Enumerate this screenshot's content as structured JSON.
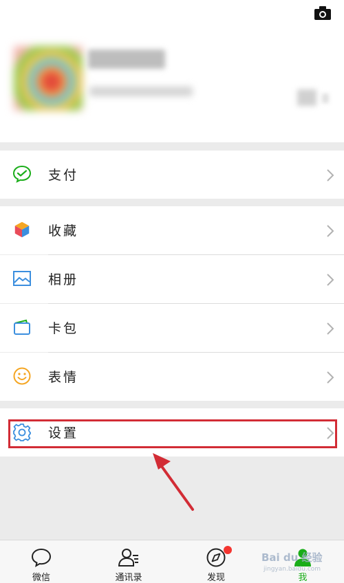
{
  "menu": {
    "pay_label": "支付",
    "favorites_label": "收藏",
    "album_label": "相册",
    "cards_label": "卡包",
    "stickers_label": "表情",
    "settings_label": "设置"
  },
  "tabbar": {
    "chats_label": "微信",
    "contacts_label": "通讯录",
    "discover_label": "发现",
    "me_label": "我"
  },
  "watermark": {
    "text": "Bai du 经验",
    "sub": "jingyan.baidu.com"
  },
  "colors": {
    "accent_green": "#1aad19",
    "highlight_red": "#d22c35",
    "badge_red": "#f43530",
    "icon_blue": "#3b8ede"
  },
  "icons": [
    "camera-icon",
    "pay-icon",
    "favorites-icon",
    "album-icon",
    "cards-icon",
    "stickers-icon",
    "settings-gear-icon",
    "chats-icon",
    "contacts-icon",
    "discover-icon",
    "me-icon"
  ]
}
